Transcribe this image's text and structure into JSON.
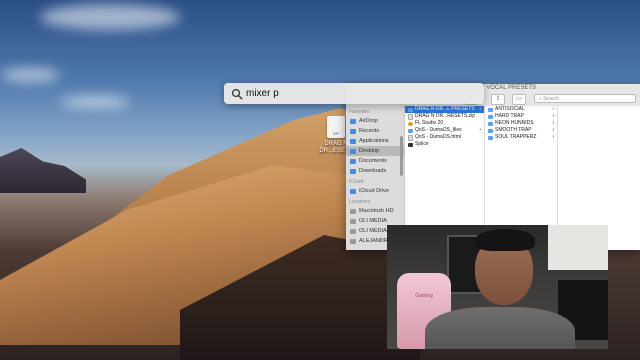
{
  "spotlight": {
    "query": "mixer p"
  },
  "desktop": {
    "file_label": "DRAG N DR...ESETS"
  },
  "finder": {
    "title": "OP VOCAL PRESETS",
    "search_placeholder": "Search",
    "sidebar": {
      "favorites_header": "Favorites",
      "favorites": [
        "AirDrop",
        "Recents",
        "Applications",
        "Desktop",
        "Documents",
        "Downloads"
      ],
      "icloud_header": "iCloud",
      "icloud": [
        "iCloud Drive"
      ],
      "locations_header": "Locations",
      "locations": [
        "Macintosh HD",
        "OLI MEDIA",
        "OLI MEDIA",
        "ALEJANDR..."
      ]
    },
    "column1": [
      "DRAG N DR...L PRESETS",
      "DRAG N DR...RESETS.zip",
      "FL Studio 20",
      "QoS - DumaOS_files",
      "QoS - DumaOS.html",
      "Splice"
    ],
    "column2": [
      "ANTISOCIAL",
      "HARD TRAP",
      "NEON HUNNIDS",
      "SMOOTH TRAP",
      "SOUL TRAPPERZ"
    ]
  },
  "webcam": {
    "chair_brand": "Gaming"
  }
}
